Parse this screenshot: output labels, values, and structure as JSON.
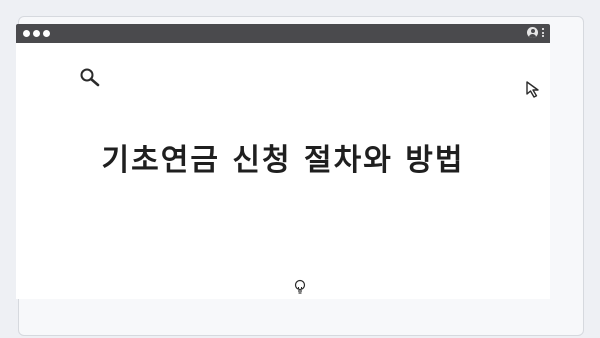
{
  "window": {
    "title": "기초연금 신청 절차와 방법"
  },
  "icons": {
    "search": "search-icon",
    "cursor": "cursor-arrow-icon",
    "bulb": "lightbulb-icon",
    "profile": "profile-icon",
    "menu": "kebab-menu-icon"
  },
  "colors": {
    "browser_bar": "#4a4a4d",
    "background": "#eef0f4",
    "content": "#ffffff",
    "title_text": "#1f1f1f"
  }
}
